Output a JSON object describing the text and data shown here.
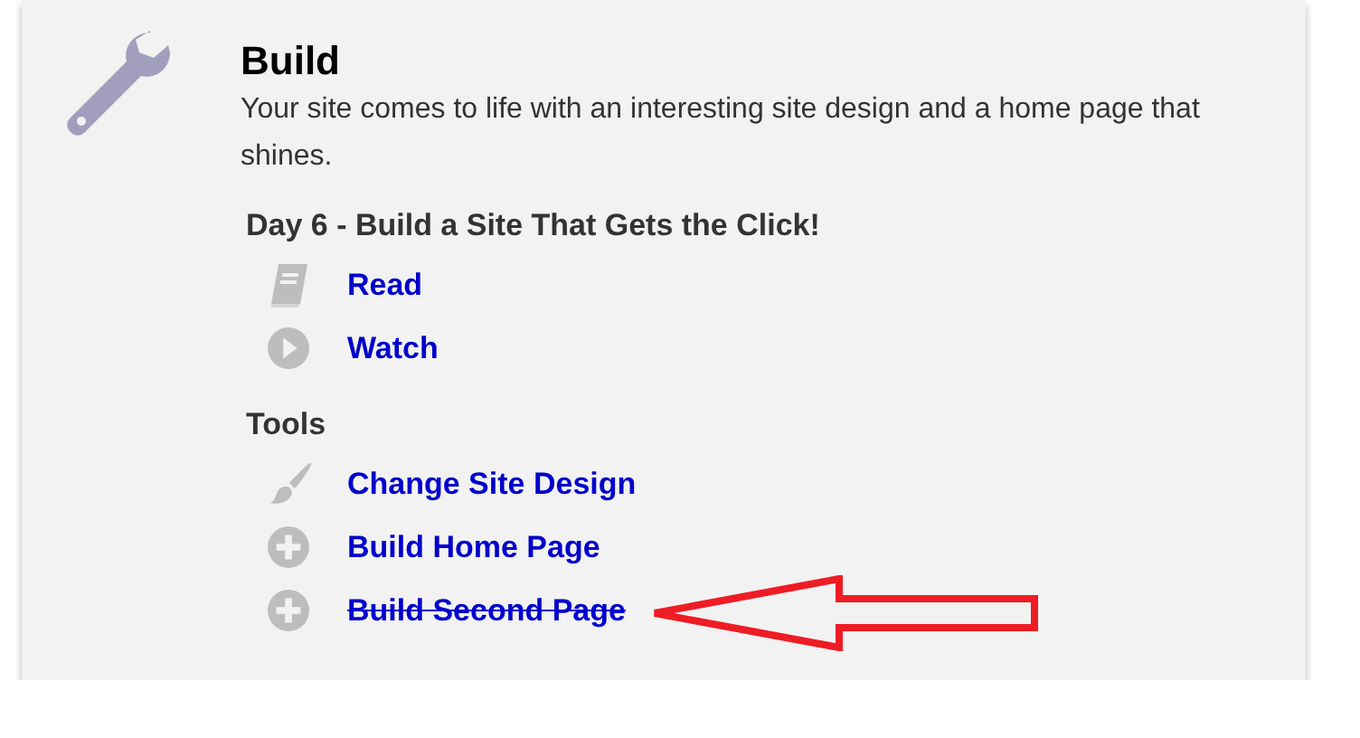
{
  "card": {
    "title": "Build",
    "description": "Your site comes to life with an interesting site design and a home page that shines."
  },
  "sections": [
    {
      "heading": "Day 6 - Build a Site That Gets the Click!",
      "items": [
        {
          "kind": "book",
          "label": "Read",
          "struck": false
        },
        {
          "kind": "play",
          "label": "Watch",
          "struck": false
        }
      ]
    },
    {
      "heading": "Tools",
      "items": [
        {
          "kind": "brush",
          "label": "Change Site Design",
          "struck": false
        },
        {
          "kind": "plus",
          "label": "Build Home Page",
          "struck": false
        },
        {
          "kind": "plus",
          "label": "Build Second Page",
          "struck": true,
          "annotated": true
        }
      ]
    }
  ]
}
